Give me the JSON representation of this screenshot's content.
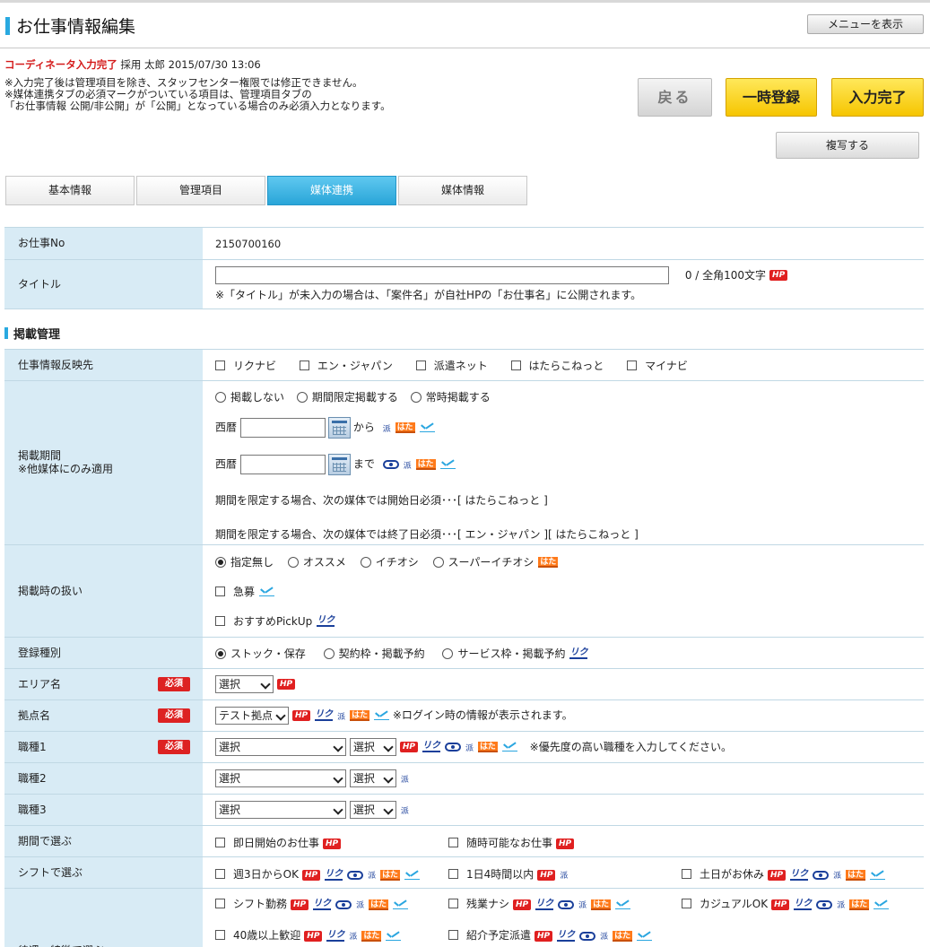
{
  "header": {
    "title": "お仕事情報編集",
    "menu_button": "メニューを表示"
  },
  "status": {
    "state": "コーディネータ入力完了",
    "user": "採用 太郎",
    "datetime": "2015/07/30 13:06"
  },
  "notes": [
    "※入力完了後は管理項目を除き、スタッフセンター権限では修正できません。",
    "※媒体連携タブの必須マークがついている項目は、管理項目タブの",
    "「お仕事情報 公開/非公開」が「公開」となっている場合のみ必須入力となります。"
  ],
  "buttons": {
    "back": "戻る",
    "temp_save": "一時登録",
    "complete": "入力完了",
    "copy": "複写する"
  },
  "tabs": [
    "基本情報",
    "管理項目",
    "媒体連携",
    "媒体情報"
  ],
  "active_tab": "媒体連携",
  "job_no": {
    "label": "お仕事No",
    "value": "2150700160"
  },
  "title_row": {
    "label": "タイトル",
    "counter": "0 / 全角100文字",
    "note": "※「タイトル」が未入力の場合は、「案件名」が自社HPの「お仕事名」に公開されます。"
  },
  "section_title": "掲載管理",
  "reflect": {
    "label": "仕事情報反映先",
    "options": [
      "リクナビ",
      "エン・ジャパン",
      "派遣ネット",
      "はたらこねっと",
      "マイナビ"
    ]
  },
  "period": {
    "label1": "掲載期間",
    "label2": "※他媒体にのみ適用",
    "radios": [
      "掲載しない",
      "期間限定掲載する",
      "常時掲載する"
    ],
    "era": "西暦",
    "from": "から",
    "to": "まで",
    "note1": "期間を限定する場合、次の媒体では開始日必須･･･[ はたらこねっと ]",
    "note2": "期間を限定する場合、次の媒体では終了日必須･･･[ エン・ジャパン ][ はたらこねっと ]"
  },
  "handling": {
    "label": "掲載時の扱い",
    "radios": [
      "指定無し",
      "オススメ",
      "イチオシ",
      "スーパーイチオシ"
    ],
    "urgent": "急募",
    "pickup": "おすすめPickUp"
  },
  "reg_type": {
    "label": "登録種別",
    "radios": [
      "ストック・保存",
      "契約枠・掲載予約",
      "サービス枠・掲載予約"
    ]
  },
  "area": {
    "label": "エリア名",
    "required": "必須",
    "select": "選択"
  },
  "base": {
    "label": "拠点名",
    "required": "必須",
    "select": "テスト拠点",
    "note": "※ログイン時の情報が表示されます。"
  },
  "job1": {
    "label": "職種1",
    "required": "必須",
    "select1": "選択",
    "select2": "選択",
    "note": "※優先度の高い職種を入力してください。"
  },
  "job2": {
    "label": "職種2",
    "select1": "選択",
    "select2": "選択"
  },
  "job3": {
    "label": "職種3",
    "select1": "選択",
    "select2": "選択"
  },
  "period_choose": {
    "label": "期間で選ぶ",
    "options": [
      "即日開始のお仕事",
      "随時可能なお仕事"
    ]
  },
  "shift_choose": {
    "label": "シフトで選ぶ",
    "options": [
      "週3日からOK",
      "1日4時間以内",
      "土日がお休み"
    ]
  },
  "treatment": {
    "label": "待遇・特徴で選ぶ",
    "options": [
      "シフト勤務",
      "残業ナシ",
      "カジュアルOK",
      "40歳以上歓迎",
      "紹介予定派遣"
    ]
  },
  "media_badges": {
    "hp": "HP",
    "riku": "リク",
    "ha": "派",
    "hata": "はた"
  }
}
